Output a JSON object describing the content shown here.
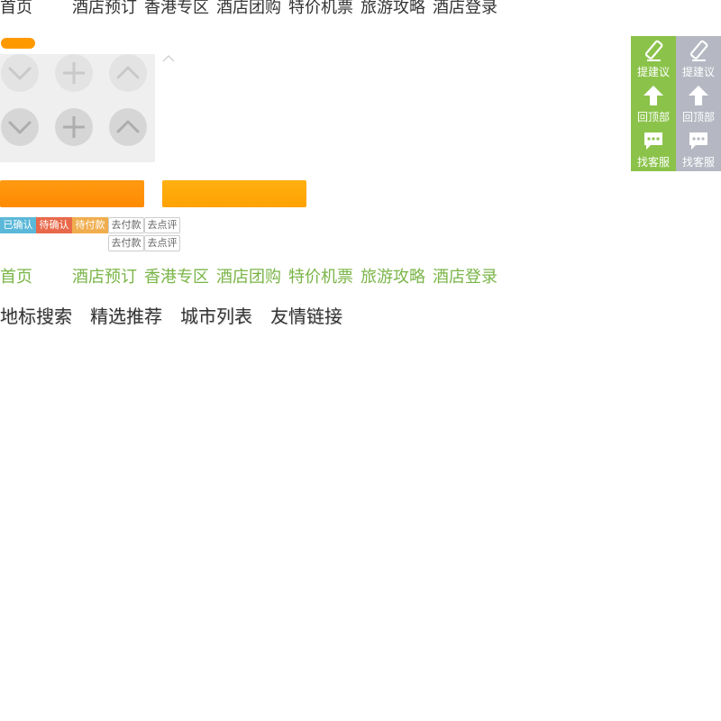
{
  "top_nav": {
    "items": [
      "首页",
      "酒店预订",
      "香港专区",
      "酒店团购",
      "特价机票",
      "旅游攻略",
      "酒店登录"
    ]
  },
  "green_nav": {
    "items": [
      "首页",
      "酒店预订",
      "香港专区",
      "酒店团购",
      "特价机票",
      "旅游攻略",
      "酒店登录"
    ]
  },
  "colors": {
    "orange": "#ff9900",
    "green": "#8bc34a",
    "gray": "#b5b8c2",
    "tag_confirmed": "#5bb8d9",
    "tag_pending_confirm": "#e8694a",
    "tag_pending_pay": "#f0ad4e"
  },
  "icon_buttons": [
    "chevron-down-icon",
    "plus-icon",
    "chevron-up-icon"
  ],
  "status_tags": {
    "confirmed": "已确认",
    "pending_confirm": "待确认",
    "pending_payment": "待付款",
    "pay_1": "去付款",
    "review_1": "去点评",
    "pay_2": "去付款",
    "review_2": "去点评"
  },
  "sidebar": {
    "green": {
      "feedback": "提建议",
      "back_to_top": "回顶部",
      "customer_service": "找客服"
    },
    "gray": {
      "feedback": "提建议",
      "back_to_top": "回顶部",
      "customer_service": "找客服"
    }
  },
  "footer_links": [
    "地标搜索",
    "精选推荐",
    "城市列表",
    "友情链接"
  ]
}
